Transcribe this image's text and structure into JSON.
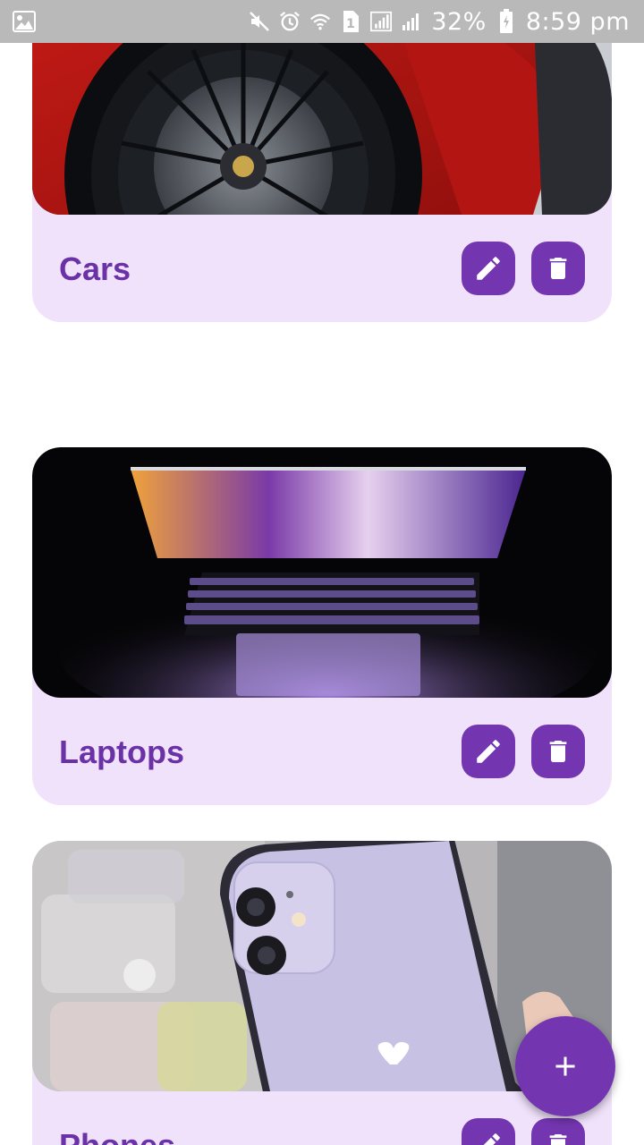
{
  "status_bar": {
    "battery": "32%",
    "time": "8:59 pm",
    "icons": [
      "gallery-icon",
      "mute-icon",
      "alarm-icon",
      "wifi-icon",
      "sim-1-icon",
      "signal-icon",
      "signal-icon-2",
      "battery-icon"
    ]
  },
  "categories": [
    {
      "title": "Cars",
      "image": "red sports car wheel"
    },
    {
      "title": "Laptops",
      "image": "laptop in dark"
    },
    {
      "title": "Phones",
      "image": "purple phone"
    }
  ],
  "colors": {
    "accent": "#7436b0",
    "card_bg": "#f0e2fb",
    "title": "#6a32a6"
  },
  "fab": {
    "icon": "plus-icon"
  }
}
